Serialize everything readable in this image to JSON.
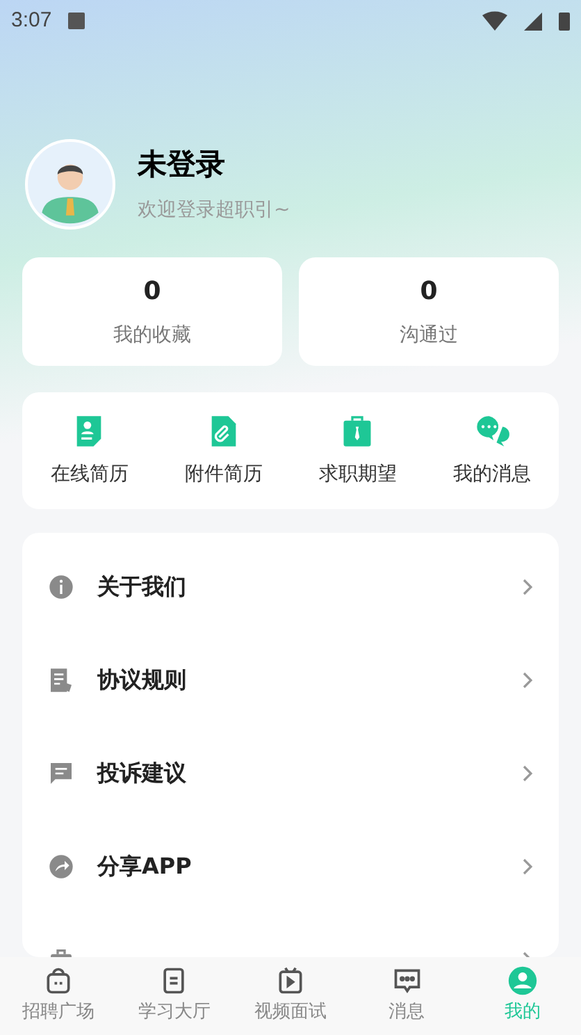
{
  "status_bar": {
    "time": "3:07"
  },
  "profile": {
    "name": "未登录",
    "subtitle": "欢迎登录超职引~"
  },
  "stats": [
    {
      "value": "0",
      "label": "我的收藏"
    },
    {
      "value": "0",
      "label": "沟通过"
    }
  ],
  "shortcuts": [
    {
      "kind": "resume",
      "label": "在线简历"
    },
    {
      "kind": "attachment",
      "label": "附件简历"
    },
    {
      "kind": "briefcase",
      "label": "求职期望"
    },
    {
      "kind": "chat",
      "label": "我的消息"
    }
  ],
  "menu": [
    {
      "kind": "info",
      "label": "关于我们"
    },
    {
      "kind": "rules",
      "label": "协议规则"
    },
    {
      "kind": "feedback",
      "label": "投诉建议"
    },
    {
      "kind": "share",
      "label": "分享APP"
    },
    {
      "kind": "hire"
    }
  ],
  "bottom_nav": [
    {
      "kind": "jobs",
      "label": "招聘广场",
      "selected": false
    },
    {
      "kind": "study",
      "label": "学习大厅",
      "selected": false
    },
    {
      "kind": "video",
      "label": "视频面试",
      "selected": false
    },
    {
      "kind": "message",
      "label": "消息",
      "selected": false
    },
    {
      "kind": "me",
      "label": "我的",
      "selected": true
    }
  ]
}
